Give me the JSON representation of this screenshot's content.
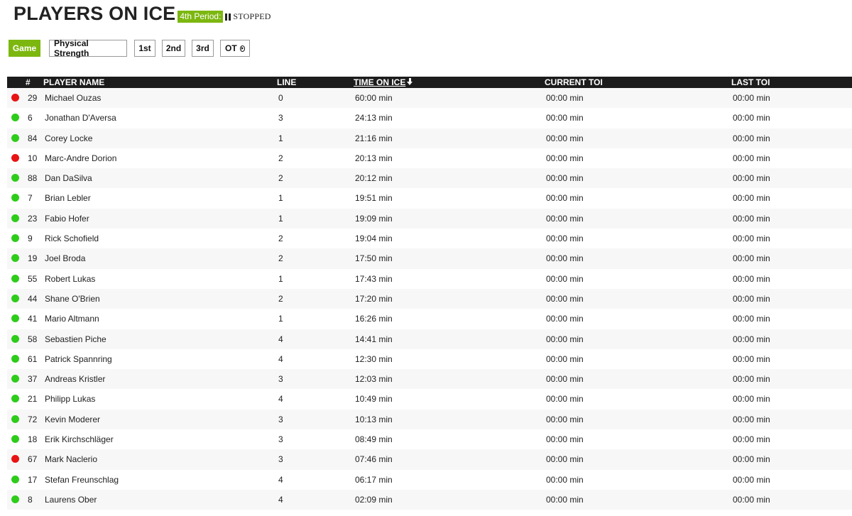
{
  "header": {
    "title": "PLAYERS ON ICE",
    "period_badge": "4th Period:",
    "status": "STOPPED",
    "status_icon": "pause-icon"
  },
  "tabs": [
    {
      "label": "Game",
      "active": true
    },
    {
      "label": "Physical Strength",
      "active": false
    },
    {
      "label": "1st",
      "active": false
    },
    {
      "label": "2nd",
      "active": false
    },
    {
      "label": "3rd",
      "active": false
    },
    {
      "label": "OT",
      "active": false,
      "icon": "play-circle-icon"
    }
  ],
  "colors": {
    "accent": "#7cb70f",
    "header_bg": "#1c1c1c",
    "status_on": "#2ecc1a",
    "status_off": "#e81313"
  },
  "table": {
    "columns": [
      "#",
      "PLAYER NAME",
      "LINE",
      "TIME ON ICE",
      "CURRENT TOI",
      "LAST TOI"
    ],
    "sorted_by": "TIME ON ICE",
    "sort_direction": "desc",
    "rows": [
      {
        "status": "off",
        "number": "29",
        "name": "Michael Ouzas",
        "line": "0",
        "toi": "60:00 min",
        "current_toi": "00:00 min",
        "last_toi": "00:00 min"
      },
      {
        "status": "on",
        "number": "6",
        "name": "Jonathan D'Aversa",
        "line": "3",
        "toi": "24:13 min",
        "current_toi": "00:00 min",
        "last_toi": "00:00 min"
      },
      {
        "status": "on",
        "number": "84",
        "name": "Corey Locke",
        "line": "1",
        "toi": "21:16 min",
        "current_toi": "00:00 min",
        "last_toi": "00:00 min"
      },
      {
        "status": "off",
        "number": "10",
        "name": "Marc-Andre Dorion",
        "line": "2",
        "toi": "20:13 min",
        "current_toi": "00:00 min",
        "last_toi": "00:00 min"
      },
      {
        "status": "on",
        "number": "88",
        "name": "Dan DaSilva",
        "line": "2",
        "toi": "20:12 min",
        "current_toi": "00:00 min",
        "last_toi": "00:00 min"
      },
      {
        "status": "on",
        "number": "7",
        "name": "Brian Lebler",
        "line": "1",
        "toi": "19:51 min",
        "current_toi": "00:00 min",
        "last_toi": "00:00 min"
      },
      {
        "status": "on",
        "number": "23",
        "name": "Fabio Hofer",
        "line": "1",
        "toi": "19:09 min",
        "current_toi": "00:00 min",
        "last_toi": "00:00 min"
      },
      {
        "status": "on",
        "number": "9",
        "name": "Rick Schofield",
        "line": "2",
        "toi": "19:04 min",
        "current_toi": "00:00 min",
        "last_toi": "00:00 min"
      },
      {
        "status": "on",
        "number": "19",
        "name": "Joel Broda",
        "line": "2",
        "toi": "17:50 min",
        "current_toi": "00:00 min",
        "last_toi": "00:00 min"
      },
      {
        "status": "on",
        "number": "55",
        "name": "Robert Lukas",
        "line": "1",
        "toi": "17:43 min",
        "current_toi": "00:00 min",
        "last_toi": "00:00 min"
      },
      {
        "status": "on",
        "number": "44",
        "name": "Shane O'Brien",
        "line": "2",
        "toi": "17:20 min",
        "current_toi": "00:00 min",
        "last_toi": "00:00 min"
      },
      {
        "status": "on",
        "number": "41",
        "name": "Mario Altmann",
        "line": "1",
        "toi": "16:26 min",
        "current_toi": "00:00 min",
        "last_toi": "00:00 min"
      },
      {
        "status": "on",
        "number": "58",
        "name": "Sebastien Piche",
        "line": "4",
        "toi": "14:41 min",
        "current_toi": "00:00 min",
        "last_toi": "00:00 min"
      },
      {
        "status": "on",
        "number": "61",
        "name": "Patrick Spannring",
        "line": "4",
        "toi": "12:30 min",
        "current_toi": "00:00 min",
        "last_toi": "00:00 min"
      },
      {
        "status": "on",
        "number": "37",
        "name": "Andreas Kristler",
        "line": "3",
        "toi": "12:03 min",
        "current_toi": "00:00 min",
        "last_toi": "00:00 min"
      },
      {
        "status": "on",
        "number": "21",
        "name": "Philipp Lukas",
        "line": "4",
        "toi": "10:49 min",
        "current_toi": "00:00 min",
        "last_toi": "00:00 min"
      },
      {
        "status": "on",
        "number": "72",
        "name": "Kevin Moderer",
        "line": "3",
        "toi": "10:13 min",
        "current_toi": "00:00 min",
        "last_toi": "00:00 min"
      },
      {
        "status": "on",
        "number": "18",
        "name": "Erik Kirchschläger",
        "line": "3",
        "toi": "08:49 min",
        "current_toi": "00:00 min",
        "last_toi": "00:00 min"
      },
      {
        "status": "off",
        "number": "67",
        "name": "Mark Naclerio",
        "line": "3",
        "toi": "07:46 min",
        "current_toi": "00:00 min",
        "last_toi": "00:00 min"
      },
      {
        "status": "on",
        "number": "17",
        "name": "Stefan Freunschlag",
        "line": "4",
        "toi": "06:17 min",
        "current_toi": "00:00 min",
        "last_toi": "00:00 min"
      },
      {
        "status": "on",
        "number": "8",
        "name": "Laurens Ober",
        "line": "4",
        "toi": "02:09 min",
        "current_toi": "00:00 min",
        "last_toi": "00:00 min"
      }
    ]
  }
}
